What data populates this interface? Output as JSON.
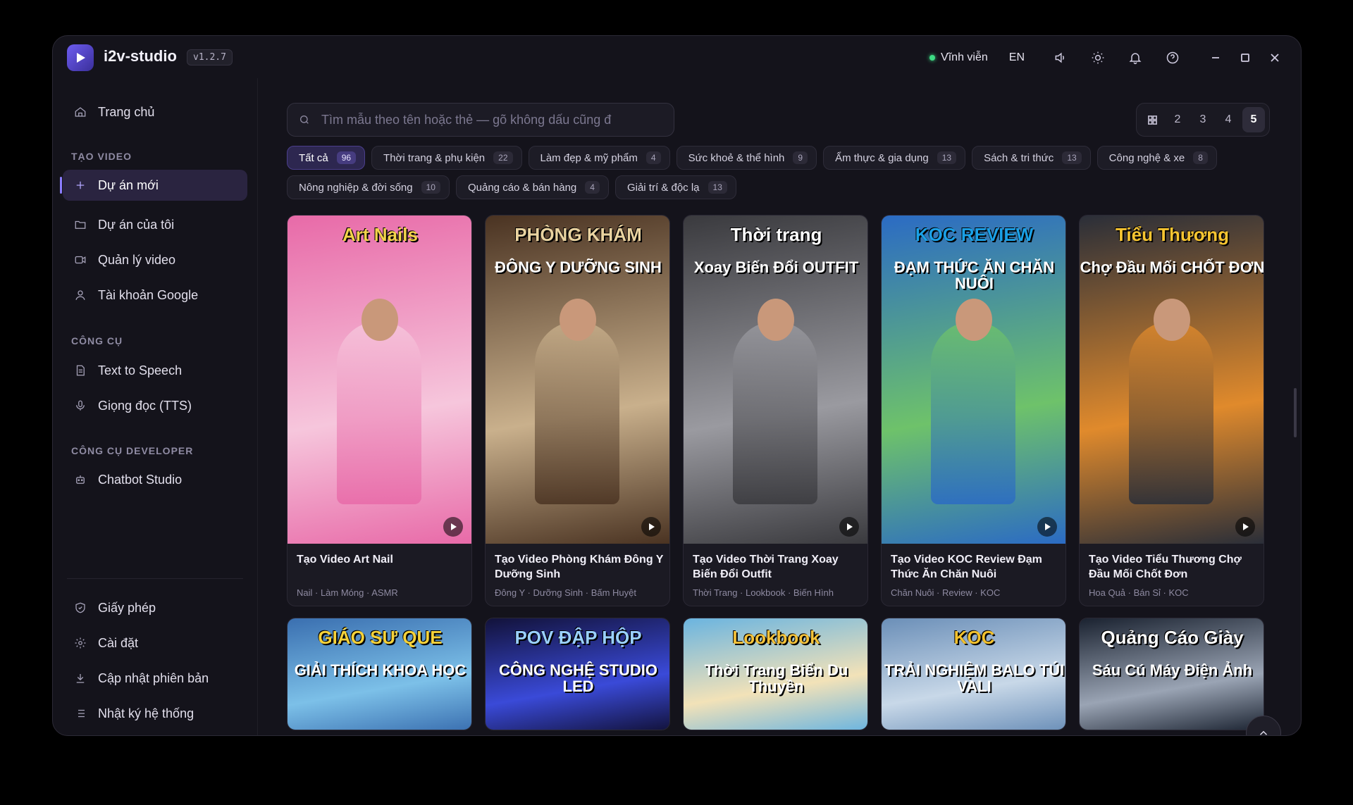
{
  "app": {
    "name": "i2v-studio",
    "version": "v1.2.7"
  },
  "titlebar": {
    "license": "Vĩnh viễn",
    "language": "EN"
  },
  "sidebar": {
    "home": "Trang chủ",
    "section_create": "TẠO VIDEO",
    "new_project": "Dự án mới",
    "my_projects": "Dự án của tôi",
    "manage_video": "Quản lý video",
    "google_account": "Tài khoản Google",
    "section_tools": "CÔNG CỤ",
    "tts": "Text to Speech",
    "voice": "Giọng đọc (TTS)",
    "section_dev": "CÔNG CỤ DEVELOPER",
    "chatbot": "Chatbot Studio",
    "license": "Giấy phép",
    "settings": "Cài đặt",
    "update": "Cập nhật phiên bản",
    "log": "Nhật ký hệ thống"
  },
  "search": {
    "placeholder": "Tìm mẫu theo tên hoặc thẻ — gõ không dấu cũng đ"
  },
  "grid_columns": {
    "options": [
      "2",
      "3",
      "4",
      "5"
    ],
    "selected": "5"
  },
  "categories": [
    {
      "label": "Tất cả",
      "count": "96",
      "active": true
    },
    {
      "label": "Thời trang & phụ kiện",
      "count": "22"
    },
    {
      "label": "Làm đẹp & mỹ phẩm",
      "count": "4"
    },
    {
      "label": "Sức khoẻ & thể hình",
      "count": "9"
    },
    {
      "label": "Ẩm thực & gia dụng",
      "count": "13"
    },
    {
      "label": "Sách & tri thức",
      "count": "13"
    },
    {
      "label": "Công nghệ & xe",
      "count": "8"
    },
    {
      "label": "Nông nghiệp & đời sống",
      "count": "10"
    },
    {
      "label": "Quảng cáo & bán hàng",
      "count": "4"
    },
    {
      "label": "Giải trí & độc lạ",
      "count": "13"
    }
  ],
  "templates": [
    {
      "title": "Tạo Video Art Nail",
      "tags": "Nail · Làm Móng · ASMR",
      "thumb_line1": "Art Nails",
      "thumb_line2": "",
      "colors": [
        "#e86aa8",
        "#f6c6dc",
        "#f2d34a"
      ]
    },
    {
      "title": "Tạo Video Phòng Khám Đông Y Dưỡng Sinh",
      "tags": "Đông Y · Dưỡng Sinh · Bấm Huyệt",
      "thumb_line1": "PHÒNG KHÁM",
      "thumb_line2": "ĐÔNG Y DƯỠNG SINH",
      "colors": [
        "#4a3322",
        "#c9b08c",
        "#e9d3a0"
      ]
    },
    {
      "title": "Tạo Video Thời Trang Xoay Biến Đổi Outfit",
      "tags": "Thời Trang · Lookbook · Biến Hình",
      "thumb_line1": "Thời trang",
      "thumb_line2": "Xoay Biến Đổi OUTFIT",
      "colors": [
        "#3a3a3e",
        "#9a9aa0",
        "#ffffff"
      ]
    },
    {
      "title": "Tạo Video KOC Review Đạm Thức Ăn Chăn Nuôi",
      "tags": "Chăn Nuôi · Review · KOC",
      "thumb_line1": "KOC REVIEW",
      "thumb_line2": "ĐẠM THỨC ĂN CHĂN NUÔI",
      "colors": [
        "#2b6bc4",
        "#6ec26a",
        "#1aa0e6"
      ]
    },
    {
      "title": "Tạo Video Tiểu Thương Chợ Đầu Mối Chốt Đơn",
      "tags": "Hoa Quả · Bán Sỉ · KOC",
      "thumb_line1": "Tiểu Thương",
      "thumb_line2": "Chợ Đầu Mối CHỐT ĐƠN",
      "colors": [
        "#2a2e38",
        "#e08a2c",
        "#f7c531"
      ]
    },
    {
      "title": "",
      "tags": "",
      "thumb_line1": "GIÁO SƯ QUE",
      "thumb_line2": "GIẢI THÍCH KHOA HỌC",
      "colors": [
        "#3a6fb0",
        "#7cc0e8",
        "#f5d23a"
      ]
    },
    {
      "title": "",
      "tags": "",
      "thumb_line1": "POV ĐẬP HỘP",
      "thumb_line2": "CÔNG NGHỆ STUDIO LED",
      "colors": [
        "#12123a",
        "#3a4ad8",
        "#9ad0ff"
      ]
    },
    {
      "title": "",
      "tags": "",
      "thumb_line1": "Lookbook",
      "thumb_line2": "Thời Trang Biển Du Thuyền",
      "colors": [
        "#6ab4e0",
        "#f2e2b8",
        "#f4c23a"
      ]
    },
    {
      "title": "",
      "tags": "",
      "thumb_line1": "KOC",
      "thumb_line2": "TRẢI NGHIỆM BALO TÚI VALI",
      "colors": [
        "#6b8fb8",
        "#c8d8e8",
        "#f2c12e"
      ]
    },
    {
      "title": "",
      "tags": "",
      "thumb_line1": "Quảng Cáo Giày",
      "thumb_line2": "Sáu Cú Máy Điện Ảnh",
      "colors": [
        "#1a2230",
        "#9aa4b4",
        "#ffffff"
      ]
    }
  ]
}
